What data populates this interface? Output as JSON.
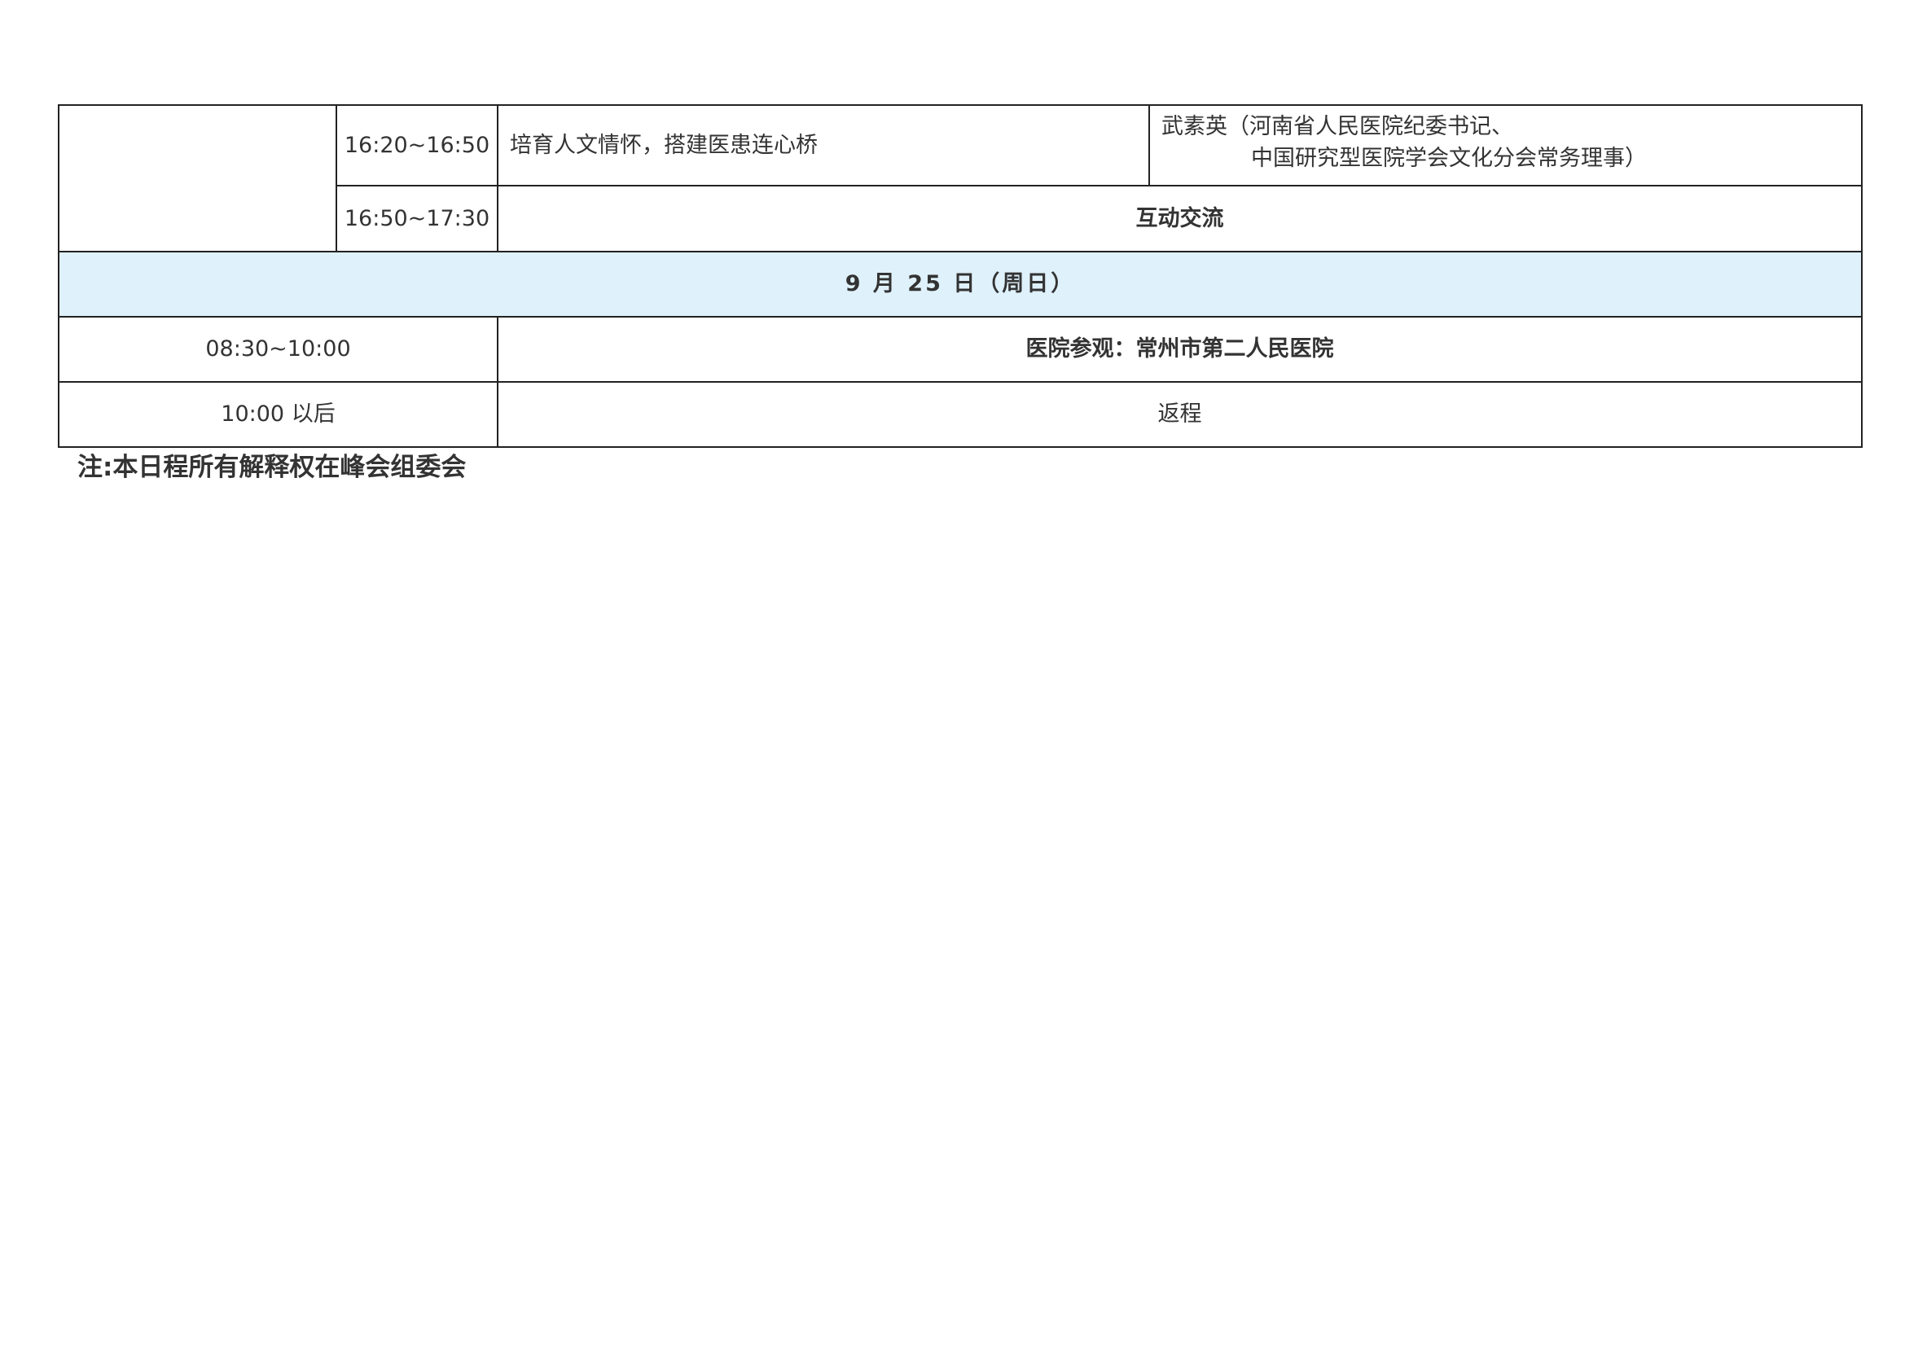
{
  "schedule": {
    "rows": [
      {
        "time": "16:20~16:50",
        "topic": "培育人文情怀，搭建医患连心桥",
        "speaker_line1": "武素英（河南省人民医院纪委书记、",
        "speaker_line2": "中国研究型医院学会文化分会常务理事）"
      },
      {
        "time": "16:50~17:30",
        "topic": "互动交流"
      }
    ],
    "day_header": "9 月 25 日（周日）",
    "day_rows": [
      {
        "time": "08:30~10:00",
        "activity": "医院参观：常州市第二人民医院"
      },
      {
        "time": "10:00 以后",
        "activity": "返程"
      }
    ]
  },
  "note": "注:本日程所有解释权在峰会组委会"
}
